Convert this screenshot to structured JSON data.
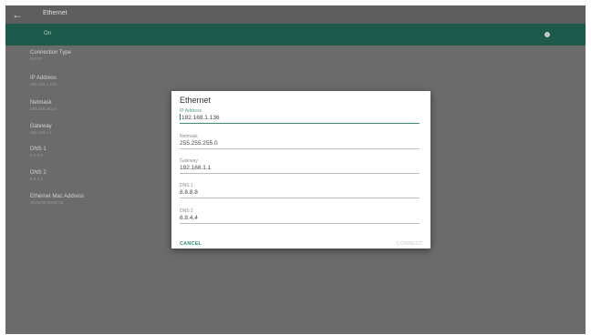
{
  "topbar": {
    "title": "Ethernet"
  },
  "toggle": {
    "label": "On",
    "state": "on"
  },
  "settings": [
    {
      "title": "Connection Type",
      "value": "DHCP"
    },
    {
      "title": "IP Address",
      "value": "192.168.1.136"
    },
    {
      "title": "Netmask",
      "value": "255.255.255.0"
    },
    {
      "title": "Gateway",
      "value": "192.168.1.1"
    },
    {
      "title": "DNS 1",
      "value": "8.8.8.8"
    },
    {
      "title": "DNS 2",
      "value": "8.8.4.4"
    },
    {
      "title": "Ethernet Mac Address",
      "value": "00:00:00:00:00:00"
    }
  ],
  "dialog": {
    "title": "Ethernet",
    "fields": [
      {
        "label": "IP Address",
        "value": "192.168.1.136"
      },
      {
        "label": "Netmask",
        "value": "255.255.255.0"
      },
      {
        "label": "Gateway",
        "value": "192.168.1.1"
      },
      {
        "label": "DNS 1",
        "value": "8.8.8.8"
      },
      {
        "label": "DNS 2",
        "value": "8.8.4.4"
      }
    ],
    "cancel_label": "CANCEL",
    "connect_label": "CONNECT"
  },
  "colors": {
    "accent": "#1e5a4b",
    "dialog_button": "#2e8a74",
    "overlay": "#6b6b6b"
  },
  "icons": {
    "back": "arrow-back-icon"
  }
}
